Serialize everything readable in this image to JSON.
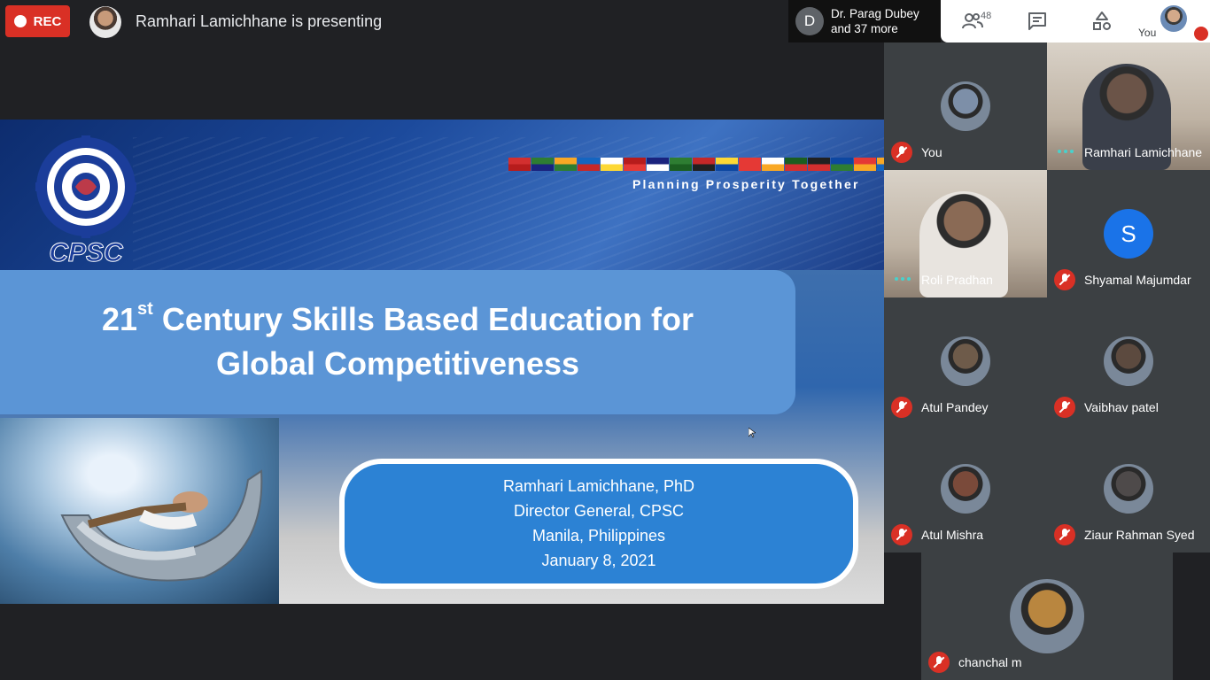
{
  "topbar": {
    "rec_label": "REC",
    "presenting_text": "Ramhari Lamichhane is presenting",
    "others_initial": "D",
    "others_line1": "Dr. Parag Dubey",
    "others_line2": "and 37 more",
    "participants_count": "48",
    "self_label": "You",
    "icons": [
      "people-icon",
      "chat-icon",
      "activities-icon",
      "mic-off-icon"
    ]
  },
  "slide": {
    "title_prefix": "21",
    "title_superscript": "st",
    "title_line1_rest": " Century Skills Based Education for",
    "title_line2": "Global Competitiveness",
    "tagline": "Planning Prosperity Together",
    "logo_text": "CPSC",
    "info_lines": [
      "Ramhari Lamichhane, PhD",
      "Director General, CPSC",
      "Manila, Philippines",
      "January 8, 2021"
    ],
    "flag_colors": [
      "#d32f2f",
      "#2e7d32",
      "#f9a825",
      "#1565c0",
      "#ffffff",
      "#b71c1c",
      "#1a237e",
      "#2e7d32",
      "#c62828",
      "#fdd835",
      "#e53935",
      "#ffffff",
      "#1b5e20",
      "#212121",
      "#0d47a1",
      "#e53935",
      "#f9a825",
      "#d32f2f"
    ]
  },
  "participants": [
    {
      "name": "You",
      "muted": true,
      "speaking": false,
      "avatar_color": "#7d8fa8",
      "video": false
    },
    {
      "name": "Ramhari Lamichhane",
      "muted": false,
      "speaking": true,
      "avatar_color": "#6b5448",
      "video": true
    },
    {
      "name": "Roli Pradhan",
      "muted": false,
      "speaking": true,
      "avatar_color": "#8a6a55",
      "video": true
    },
    {
      "name": "Shyamal Majumdar",
      "muted": true,
      "speaking": false,
      "initial": "S",
      "avatar_color": "#1a73e8",
      "video": false
    },
    {
      "name": "Atul Pandey",
      "muted": true,
      "speaking": false,
      "avatar_color": "#6e5b4a",
      "video": false
    },
    {
      "name": "Vaibhav patel",
      "muted": true,
      "speaking": false,
      "avatar_color": "#5c4a3f",
      "video": false
    },
    {
      "name": "Atul Mishra",
      "muted": true,
      "speaking": false,
      "avatar_color": "#7a4a3a",
      "video": false
    },
    {
      "name": "Ziaur Rahman Syed",
      "muted": true,
      "speaking": false,
      "avatar_color": "#4e4a4a",
      "video": false
    },
    {
      "name": "chanchal m",
      "muted": true,
      "speaking": false,
      "avatar_color": "#b9863f",
      "video": false
    }
  ]
}
